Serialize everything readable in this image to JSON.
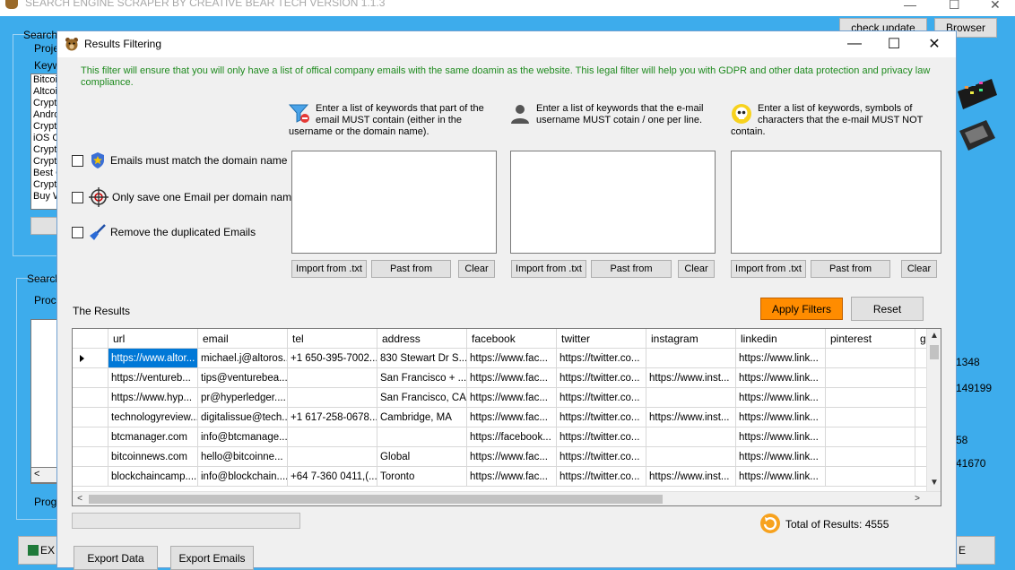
{
  "background": {
    "title": "SEARCH ENGINE SCRAPER BY CREATIVE BEAR TECH VERSION 1.1.3",
    "check_update": "check update",
    "browser": "Browser",
    "search_label": "Search",
    "project_label": "Projec",
    "keywords_label": "Keyw",
    "keyword_list": [
      "Bitcoi",
      "Altcoi",
      "Crypto",
      "Andro",
      "Crypto",
      "iOS C",
      "Crypto",
      "Crypto",
      "Best C",
      "Crypto",
      "Buy W"
    ],
    "search2_label": "Search",
    "process_label": "Proce",
    "progress_label": "Progr",
    "export_label": "EX",
    "right_numbers": [
      "1348",
      "149199",
      "58",
      "41670"
    ],
    "e_label": "E"
  },
  "dialog": {
    "title": "Results Filtering",
    "info": "This filter will ensure that you will only have a list of offical company emails with the same doamin as the website. This legal filter will help you with GDPR and other data protection and privacy law compliance.",
    "checkboxes": [
      {
        "label": "Emails must match the domain name"
      },
      {
        "label": "Only save one Email per domain name"
      },
      {
        "label": "Remove the duplicated Emails"
      }
    ],
    "keyword_panels": [
      {
        "text": "Enter a list of keywords that part of the email MUST contain (either in the username or the domain name).",
        "import": "Import from .txt",
        "paste": "Past from",
        "clear": "Clear"
      },
      {
        "text": "Enter a list of keywords that the e-mail username MUST cotain / one per line.",
        "import": "Import from .txt",
        "paste": "Past from",
        "clear": "Clear"
      },
      {
        "text": "Enter a list of keywords, symbols of characters that the e-mail MUST NOT contain.",
        "import": "Import from .txt",
        "paste": "Past from",
        "clear": "Clear"
      }
    ],
    "results_label": "The Results",
    "apply_filters": "Apply Filters",
    "reset": "Reset",
    "total": "Total of Results: 4555",
    "export_data": "Export Data",
    "export_emails": "Export Emails",
    "accent_color": "#ff8c00",
    "info_color": "#1e8a1e"
  },
  "table": {
    "columns": [
      "url",
      "email",
      "tel",
      "address",
      "facebook",
      "twitter",
      "instagram",
      "linkedin",
      "pinterest",
      "g"
    ],
    "rows": [
      [
        "https://www.altor...",
        "michael.j@altoros...",
        "+1 650-395-7002...",
        "830 Stewart Dr S...",
        "https://www.fac...",
        "https://twitter.co...",
        "",
        "https://www.link...",
        "",
        ""
      ],
      [
        "https://ventureb...",
        "tips@venturebea...",
        "",
        "San Francisco + ...",
        "https://www.fac...",
        "https://twitter.co...",
        "https://www.inst...",
        "https://www.link...",
        "",
        ""
      ],
      [
        "https://www.hyp...",
        "pr@hyperledger....",
        "",
        "San Francisco, CA",
        "https://www.fac...",
        "https://twitter.co...",
        "",
        "https://www.link...",
        "",
        ""
      ],
      [
        "technologyreview...",
        "digitalissue@tech...",
        "+1 617-258-0678...",
        "Cambridge, MA",
        "https://www.fac...",
        "https://twitter.co...",
        "https://www.inst...",
        "https://www.link...",
        "",
        ""
      ],
      [
        "btcmanager.com",
        "info@btcmanage...",
        "",
        "",
        "https://facebook...",
        "https://twitter.co...",
        "",
        "https://www.link...",
        "",
        ""
      ],
      [
        "bitcoinnews.com",
        "hello@bitcoinne...",
        "",
        "Global",
        "https://www.fac...",
        "https://twitter.co...",
        "",
        "https://www.link...",
        "",
        ""
      ],
      [
        "blockchaincamp....",
        "info@blockchain....",
        "+64 7-360 0411,(...",
        "Toronto",
        "https://www.fac...",
        "https://twitter.co...",
        "https://www.inst...",
        "https://www.link...",
        "",
        ""
      ]
    ]
  }
}
